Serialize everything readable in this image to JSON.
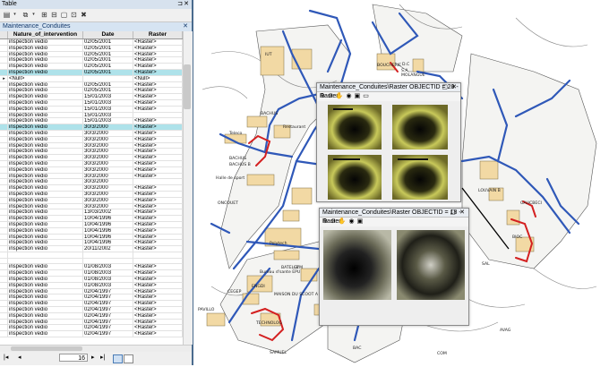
{
  "table_panel": {
    "title": "Table",
    "pin_icon": "⊐",
    "close_icon": "✕",
    "tab_label": "Maintenance_Conduites",
    "columns": [
      "Nature_of_intervention",
      "Date",
      "Raster"
    ],
    "rows": [
      {
        "n": "inspection vedio",
        "d": "02/05/2001",
        "r": "<Raster>"
      },
      {
        "n": "inspection vedio",
        "d": "02/05/2001",
        "r": "<Raster>"
      },
      {
        "n": "inspection vedio",
        "d": "02/05/2001",
        "r": "<Raster>"
      },
      {
        "n": "inspection vedio",
        "d": "02/05/2001",
        "r": "<Raster>"
      },
      {
        "n": "inspection vedio",
        "d": "02/05/2001",
        "r": "<Raster>"
      },
      {
        "n": "inspection vedio",
        "d": "02/05/2001",
        "r": "<Raster>",
        "sel": true
      },
      {
        "n": "<Null>",
        "d": "",
        "r": "<Null>",
        "cur": true
      },
      {
        "n": "inspection vedio",
        "d": "02/05/2001",
        "r": "<Raster>"
      },
      {
        "n": "inspection vedio",
        "d": "02/05/2001",
        "r": "<Raster>"
      },
      {
        "n": "inspection vedio",
        "d": "15/01/2003",
        "r": "<Raster>"
      },
      {
        "n": "inspection vedio",
        "d": "15/01/2003",
        "r": "<Raster>"
      },
      {
        "n": "inspection vedio",
        "d": "15/01/2003",
        "r": "<Raster>"
      },
      {
        "n": "inspection vedio",
        "d": "15/01/2003",
        "r": ""
      },
      {
        "n": "inspection vedio",
        "d": "15/01/2003",
        "r": "<Raster>"
      },
      {
        "n": "inspection vedio",
        "d": "30/3/2000",
        "r": "<Raster>",
        "sel": true
      },
      {
        "n": "inspection vedio",
        "d": "30/3/2000",
        "r": "<Raster>"
      },
      {
        "n": "inspection vedio",
        "d": "30/3/2000",
        "r": "<Raster>"
      },
      {
        "n": "inspection vedio",
        "d": "30/3/2000",
        "r": "<Raster>"
      },
      {
        "n": "inspection vedio",
        "d": "30/3/2000",
        "r": "<Raster>"
      },
      {
        "n": "inspection vedio",
        "d": "30/3/2000",
        "r": "<Raster>"
      },
      {
        "n": "inspection vedio",
        "d": "30/3/2000",
        "r": "<Raster>"
      },
      {
        "n": "inspection vedio",
        "d": "30/3/2000",
        "r": "<Raster>"
      },
      {
        "n": "inspection vedio",
        "d": "30/3/2000",
        "r": "<Raster>"
      },
      {
        "n": "inspection vedio",
        "d": "30/3/2000",
        "r": ""
      },
      {
        "n": "inspection vedio",
        "d": "30/3/2000",
        "r": "<Raster>"
      },
      {
        "n": "inspection vedio",
        "d": "30/3/2000",
        "r": "<Raster>"
      },
      {
        "n": "inspection vedio",
        "d": "30/3/2000",
        "r": "<Raster>"
      },
      {
        "n": "inspection vedio",
        "d": "30/3/2000",
        "r": "<Raster>"
      },
      {
        "n": "inspection vedio",
        "d": "13/03/2002",
        "r": "<Raster>"
      },
      {
        "n": "inspection vedio",
        "d": "10/04/1996",
        "r": "<Raster>"
      },
      {
        "n": "inspection vedio",
        "d": "10/04/1996",
        "r": "<Raster>"
      },
      {
        "n": "inspection vedio",
        "d": "10/04/1996",
        "r": "<Raster>"
      },
      {
        "n": "inspection vedio",
        "d": "10/04/1996",
        "r": "<Raster>"
      },
      {
        "n": "inspection vedio",
        "d": "10/04/1996",
        "r": "<Raster>"
      },
      {
        "n": "inspection vedio",
        "d": "20/11/2002",
        "r": "<Raster>"
      },
      {
        "n": "",
        "d": "",
        "r": ""
      },
      {
        "n": "",
        "d": "",
        "r": ""
      },
      {
        "n": "inspection vedio",
        "d": "01/08/2003",
        "r": "<Raster>"
      },
      {
        "n": "inspection vedio",
        "d": "01/08/2003",
        "r": "<Raster>"
      },
      {
        "n": "inspection vedio",
        "d": "01/08/2003",
        "r": "<Raster>"
      },
      {
        "n": "inspection vedio",
        "d": "01/08/2003",
        "r": "<Raster>"
      },
      {
        "n": "inspection vedio",
        "d": "02/04/1997",
        "r": "<Raster>"
      },
      {
        "n": "inspection vedio",
        "d": "02/04/1997",
        "r": "<Raster>"
      },
      {
        "n": "inspection vedio",
        "d": "02/04/1997",
        "r": "<Raster>"
      },
      {
        "n": "inspection vedio",
        "d": "02/04/1997",
        "r": "<Raster>"
      },
      {
        "n": "inspection vedio",
        "d": "02/04/1997",
        "r": "<Raster>"
      },
      {
        "n": "inspection vedio",
        "d": "02/04/1997",
        "r": "<Raster>"
      },
      {
        "n": "inspection vedio",
        "d": "02/04/1997",
        "r": "<Raster>"
      },
      {
        "n": "inspection vedio",
        "d": "02/04/1997",
        "r": "<Raster>"
      }
    ],
    "record_number": "16",
    "nav_first": "|◂",
    "nav_prev": "◂",
    "nav_next": "▸",
    "nav_last": "▸|"
  },
  "raster_windows": [
    {
      "title": "Maintenance_Conduites\\Raster OBJECTID = 28 - Raster"
    },
    {
      "title": "Maintenance_Conduites\\Raster OBJECTID = 18 - Raster"
    }
  ],
  "map_labels": [
    "BOUCHERIE",
    "D.C",
    "S.A",
    "MOLANGUE",
    "IUT",
    "BACHUS",
    "Restaurant",
    "Teleco",
    "BACHUS",
    "BACHUS B",
    "Halle de sport",
    "ONCOUET",
    "Polytech",
    "Bureau d'sante EPU",
    "ENGDI",
    "CEGEP",
    "BATELLE",
    "GYM",
    "MOLANGUE",
    "CAMPUS",
    "GAUCBECI",
    "LOUVAIN B",
    "BIOC",
    "SAL",
    "MAISON DU SCOOT A",
    "PAVILLO",
    "TECHNOLOG",
    "SAMUEL",
    "BAC",
    "AVAG",
    "COM"
  ],
  "colors": {
    "pipe_blue": "#2f58b8",
    "pipe_red": "#d42020",
    "building_fill": "#f2d9a4",
    "selected_row": "#aee2ea"
  }
}
